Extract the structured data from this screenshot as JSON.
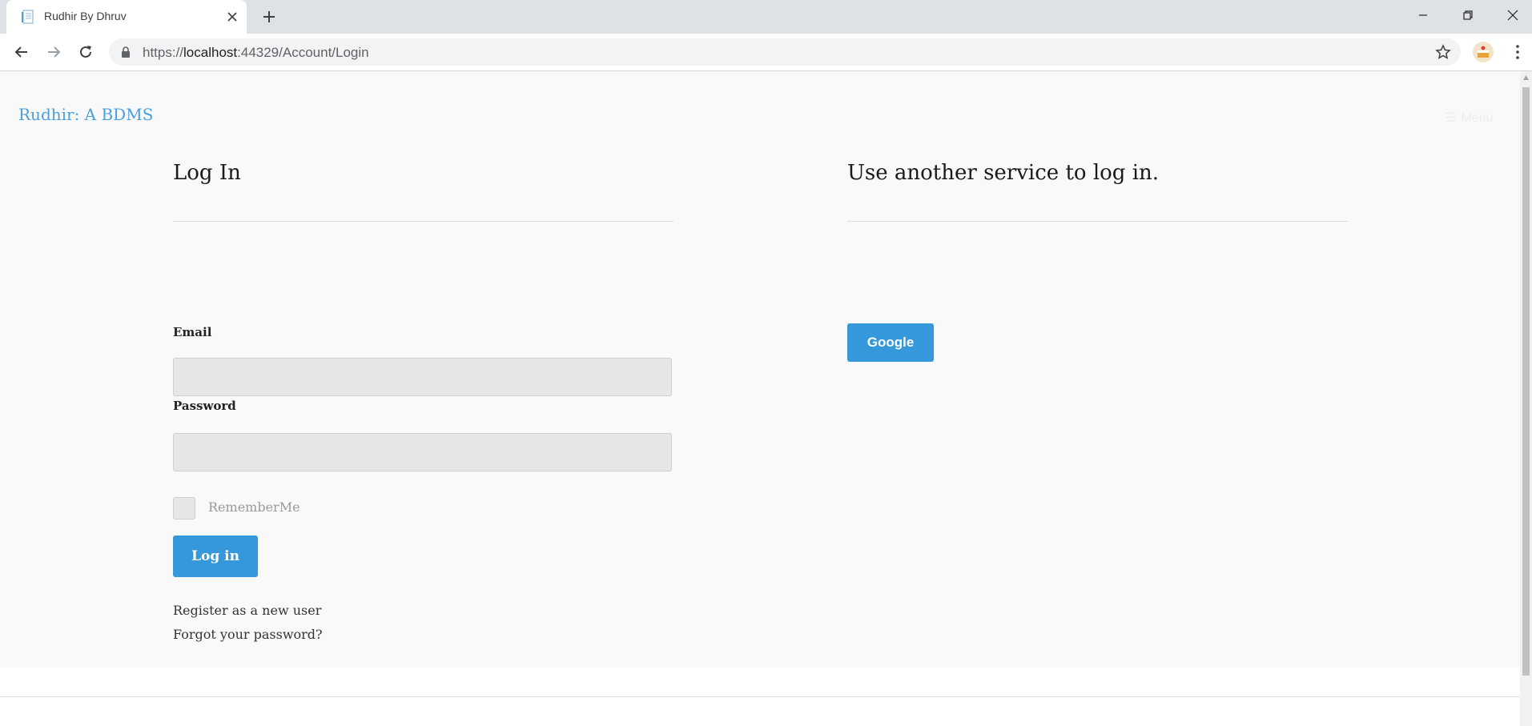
{
  "browser": {
    "tab_title": "Rudhir By Dhruv",
    "url_scheme": "https://",
    "url_host": "localhost",
    "url_path": ":44329/Account/Login"
  },
  "site": {
    "brand": "Rudhir: A BDMS",
    "menu_label": "Menu"
  },
  "login": {
    "heading": "Log In",
    "email_label": "Email",
    "email_value": "",
    "password_label": "Password",
    "password_value": "",
    "remember_label": "RememberMe",
    "remember_checked": false,
    "submit_label": "Log in",
    "register_link": "Register as a new user",
    "forgot_link": "Forgot your password?"
  },
  "external": {
    "heading": "Use another service to log in.",
    "google_label": "Google"
  },
  "colors": {
    "accent": "#3598db",
    "brand_link": "#4a9fe0",
    "page_background": "#f9f9f9",
    "input_background": "#e6e6e6"
  }
}
